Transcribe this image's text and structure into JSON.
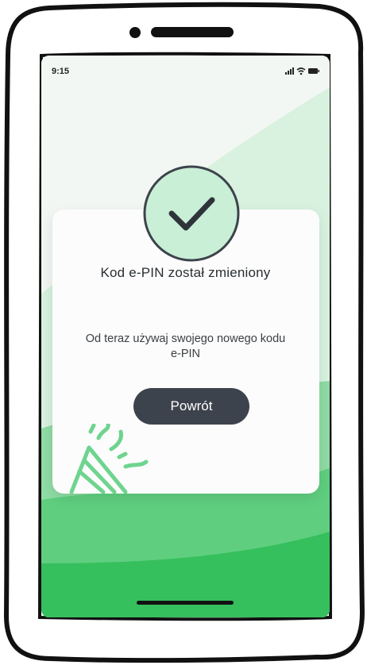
{
  "status_bar": {
    "time": "9:15",
    "signal_icon": "signal-bars-icon",
    "wifi_icon": "wifi-icon",
    "battery_icon": "battery-icon"
  },
  "dialog": {
    "status_icon": "checkmark-icon",
    "title": "Kod e-PIN został zmieniony",
    "message_line1": "Od teraz używaj swojego nowego kodu",
    "message_line2": "e-PIN",
    "button_label": "Powrót",
    "decoration_icon": "party-popper-icon"
  },
  "colors": {
    "accent_green": "#3fc46a",
    "light_green": "#cfeeda",
    "button_dark": "#3d434c",
    "check_circle": "#c9efd6"
  }
}
